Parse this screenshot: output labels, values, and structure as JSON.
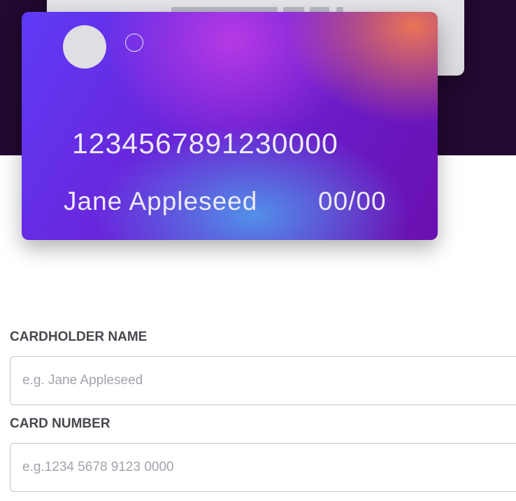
{
  "card": {
    "number": "1234567891230000",
    "name": "Jane Appleseed",
    "expiry": "00/00"
  },
  "form": {
    "cardholder_name": {
      "label": "CARDHOLDER NAME",
      "placeholder": "e.g. Jane Appleseed",
      "value": ""
    },
    "card_number": {
      "label": "CARD NUMBER",
      "placeholder": "e.g.1234 5678 9123 0000",
      "value": ""
    }
  },
  "colors": {
    "hero_background": "#21092f",
    "card_gradient_start": "#5e3bf6",
    "card_gradient_end": "#6a10b0",
    "label_text": "#4a4750",
    "placeholder_text": "#a4a2ab"
  }
}
